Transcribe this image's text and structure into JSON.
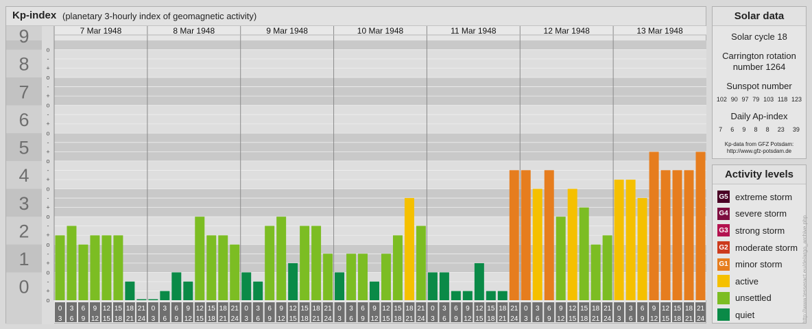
{
  "header": {
    "title": "Kp-index",
    "subtitle": "(planetary 3-hourly index of geomagnetic activity)"
  },
  "chart_data": {
    "type": "bar",
    "days": [
      "7 Mar 1948",
      "8 Mar 1948",
      "9 Mar 1948",
      "10 Mar 1948",
      "11 Mar 1948",
      "12 Mar 1948",
      "13 Mar 1948"
    ],
    "interval_start": [
      "0",
      "3",
      "6",
      "9",
      "12",
      "15",
      "18",
      "21"
    ],
    "interval_end": [
      "3",
      "6",
      "9",
      "12",
      "15",
      "18",
      "21",
      "24"
    ],
    "values": [
      [
        2.33,
        2.67,
        2.0,
        2.33,
        2.33,
        2.33,
        0.67,
        0.0
      ],
      [
        0.0,
        0.33,
        1.0,
        0.67,
        3.0,
        2.33,
        2.33,
        2.0
      ],
      [
        1.0,
        0.67,
        2.67,
        3.0,
        1.33,
        2.67,
        2.67,
        1.67
      ],
      [
        1.0,
        1.67,
        1.67,
        0.67,
        1.67,
        2.33,
        3.67,
        2.67
      ],
      [
        1.0,
        1.0,
        0.33,
        0.33,
        1.33,
        0.33,
        0.33,
        4.67
      ],
      [
        4.67,
        4.0,
        4.67,
        3.0,
        4.0,
        3.33,
        2.0,
        2.33
      ],
      [
        4.33,
        4.33,
        3.67,
        5.33,
        4.67,
        4.67,
        4.67,
        5.33
      ]
    ],
    "y_ticks": [
      "0",
      "1",
      "2",
      "3",
      "4",
      "5",
      "6",
      "7",
      "8",
      "9"
    ],
    "y_minor_ticks": [
      "o",
      "+",
      "-"
    ],
    "ylim": [
      0,
      9.33
    ],
    "colors": {
      "quiet": "#0a8a47",
      "unsettled": "#7cbd23",
      "active": "#f5c000",
      "minor_storm": "#e67d1e",
      "moderate_storm": "#cc3a1d",
      "strong_storm": "#b3124f",
      "severe_storm": "#7e0d3f",
      "extreme_storm": "#4a0025"
    }
  },
  "solar_data": {
    "title": "Solar data",
    "solar_cycle": "Solar cycle 18",
    "carrington_line1": "Carrington rotation",
    "carrington_line2": "number 1264",
    "sunspot_title": "Sunspot number",
    "sunspot_values": [
      "102",
      "90",
      "97",
      "79",
      "103",
      "118",
      "123"
    ],
    "ap_title": "Daily Ap-index",
    "ap_values": [
      "7",
      "6",
      "9",
      "8",
      "8",
      "23",
      "39"
    ],
    "source_line1": "Kp-data from GFZ Potsdam:",
    "source_line2": "http://www.gfz-potsdam.de"
  },
  "activity_levels": {
    "title": "Activity levels",
    "items": [
      {
        "code": "G5",
        "label": "extreme storm",
        "color": "#4a0025"
      },
      {
        "code": "G4",
        "label": "severe storm",
        "color": "#7e0d3f"
      },
      {
        "code": "G3",
        "label": "strong storm",
        "color": "#b3124f"
      },
      {
        "code": "G2",
        "label": "moderate storm",
        "color": "#cc3a1d"
      },
      {
        "code": "G1",
        "label": "minor storm",
        "color": "#e67d1e"
      },
      {
        "code": "",
        "label": "active",
        "color": "#f5c000"
      },
      {
        "code": "",
        "label": "unsettled",
        "color": "#7cbd23"
      },
      {
        "code": "",
        "label": "quiet",
        "color": "#0a8a47"
      }
    ]
  },
  "watermark": "http://www.tesseract.eu/de/argo_archive.php"
}
